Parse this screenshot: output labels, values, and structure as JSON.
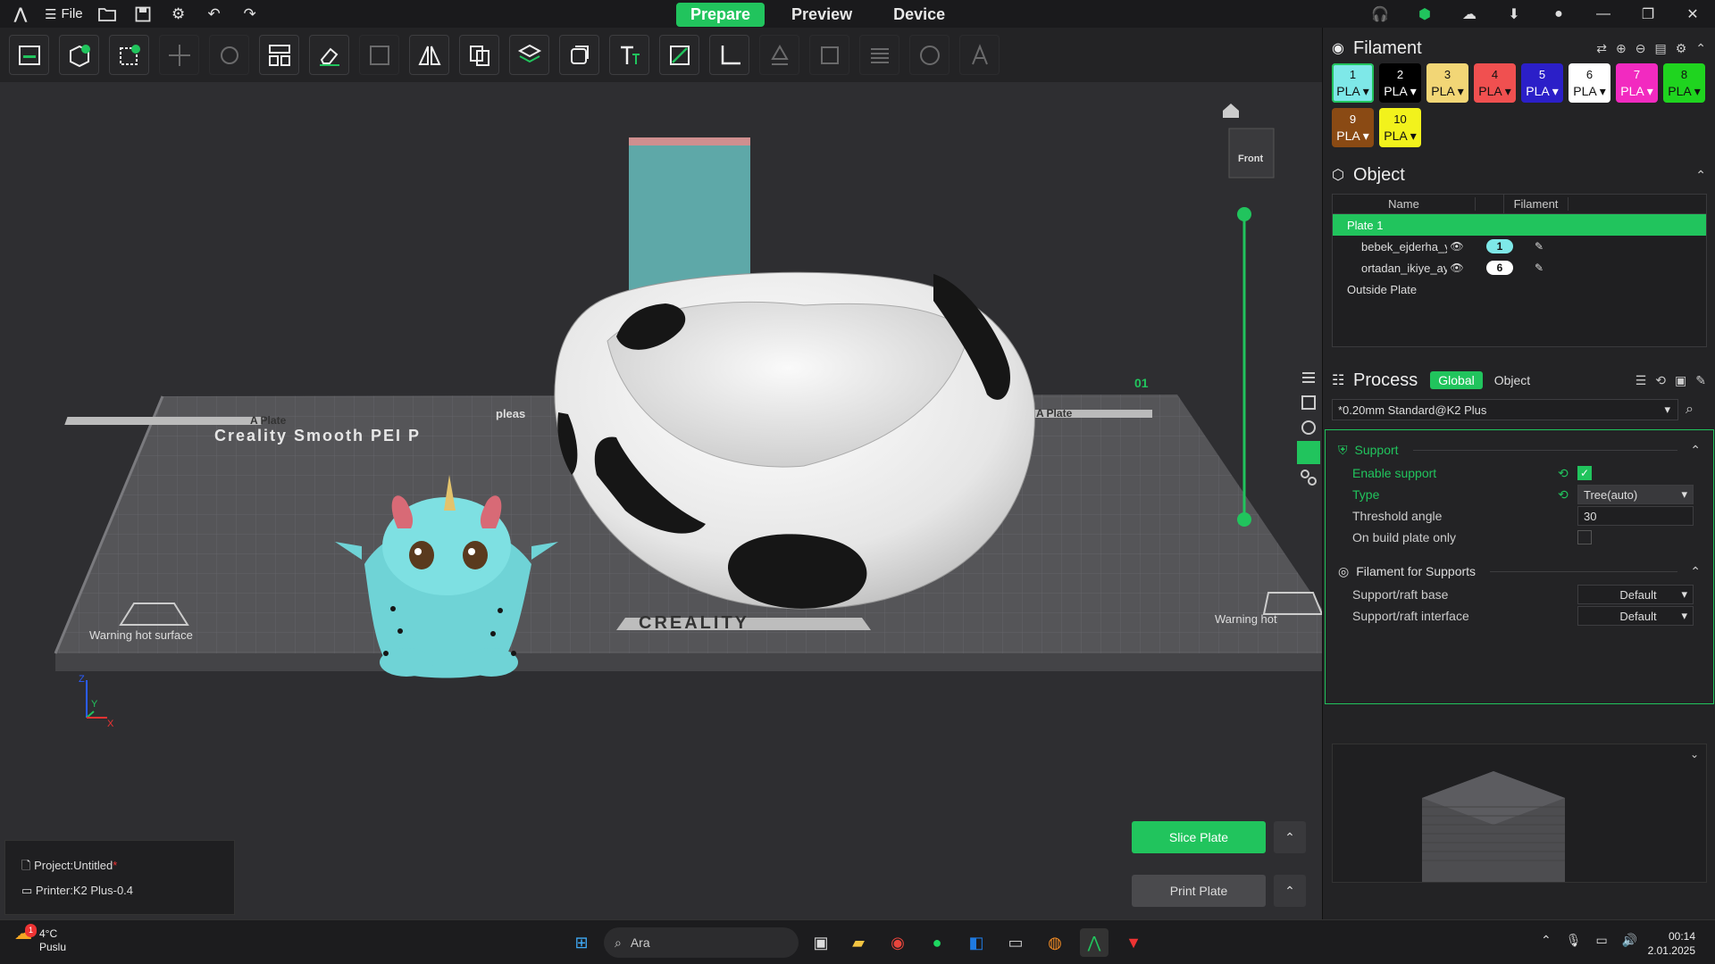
{
  "titlebar": {
    "file_label": "File",
    "tabs": [
      "Prepare",
      "Preview",
      "Device"
    ]
  },
  "toolbar": {
    "tools": [
      "add-plate",
      "add-object",
      "add-part",
      "move",
      "rotate",
      "arrange",
      "erase",
      "scale",
      "mirror",
      "split",
      "layers",
      "cut",
      "text",
      "paint",
      "measure",
      "support-paint",
      "seam-paint",
      "layer-view",
      "fuzzy",
      "font"
    ]
  },
  "viewport": {
    "front_label": "Front",
    "plate_number": "01",
    "plate_text_1": "Creality Smooth PEI P",
    "plate_text_2": "A Plate",
    "plate_text_3": "pleas",
    "plate_text_4": "A Plate",
    "brand_text": "CREALITY",
    "warn_left": "Warning hot surface",
    "warn_right": "Warning hot",
    "axis_z": "Z",
    "axis_y": "Y",
    "axis_x": "X"
  },
  "filament": {
    "title": "Filament",
    "items": [
      {
        "num": "1",
        "type": "PLA",
        "bg": "#7ee8e8",
        "fg": "#111"
      },
      {
        "num": "2",
        "type": "PLA",
        "bg": "#000000",
        "fg": "#fff"
      },
      {
        "num": "3",
        "type": "PLA",
        "bg": "#f2d676",
        "fg": "#111"
      },
      {
        "num": "4",
        "type": "PLA",
        "bg": "#f05050",
        "fg": "#111"
      },
      {
        "num": "5",
        "type": "PLA",
        "bg": "#2b1fc8",
        "fg": "#fff"
      },
      {
        "num": "6",
        "type": "PLA",
        "bg": "#ffffff",
        "fg": "#111"
      },
      {
        "num": "7",
        "type": "PLA",
        "bg": "#f22ac0",
        "fg": "#fff"
      },
      {
        "num": "8",
        "type": "PLA",
        "bg": "#1fd41f",
        "fg": "#111"
      },
      {
        "num": "9",
        "type": "PLA",
        "bg": "#8a4a14",
        "fg": "#fff"
      },
      {
        "num": "10",
        "type": "PLA",
        "bg": "#f2f21c",
        "fg": "#111"
      }
    ]
  },
  "object": {
    "title": "Object",
    "col_name": "Name",
    "col_filament": "Filament",
    "plate": "Plate 1",
    "rows": [
      {
        "name": "bebek_ejderha_yuvarla",
        "filament": "1",
        "chip_bg": "#7ee8e8"
      },
      {
        "name": "ortadan_ikiye_ayrılm_C",
        "filament": "6",
        "chip_bg": "#ffffff"
      }
    ],
    "outside": "Outside Plate"
  },
  "process": {
    "title": "Process",
    "tab_global": "Global",
    "tab_object": "Object",
    "preset": "*0.20mm Standard@K2 Plus",
    "group_support": "Support",
    "enable_support": "Enable support",
    "enable_support_checked": true,
    "type_label": "Type",
    "type_value": "Tree(auto)",
    "threshold_label": "Threshold angle",
    "threshold_value": "30",
    "build_plate_label": "On build plate only",
    "build_plate_checked": false,
    "group_filament": "Filament for Supports",
    "raft_base_label": "Support/raft base",
    "raft_base_value": "Default",
    "raft_interface_label": "Support/raft interface",
    "raft_interface_value": "Default"
  },
  "project": {
    "project_label": "Project:Untitled",
    "modified_mark": "*",
    "printer_label": "Printer:K2 Plus-0.4"
  },
  "actions": {
    "slice": "Slice Plate",
    "print": "Print Plate"
  },
  "taskbar": {
    "temp": "4°C",
    "weather": "Puslu",
    "badge": "1",
    "search": "Ara",
    "time": "00:14",
    "date": "2.01.2025"
  }
}
